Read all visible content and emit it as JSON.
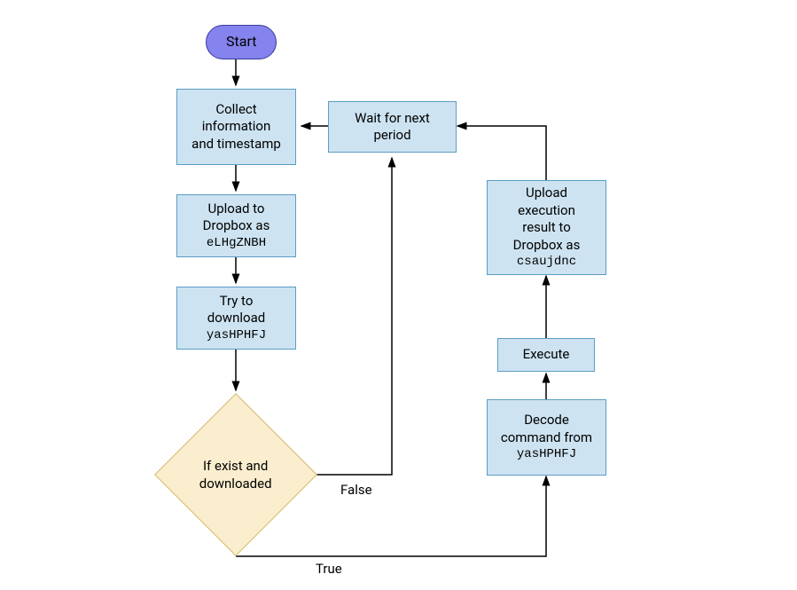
{
  "nodes": {
    "start": "Start",
    "collect": "Collect information and timestamp",
    "upload1_line1": "Upload to Dropbox as",
    "upload1_code": "eLHgZNBH",
    "download_line1": "Try to download",
    "download_code": "yasHPHFJ",
    "decision": "If exist and downloaded",
    "wait": "Wait for next period",
    "decode_line1": "Decode command from",
    "decode_code": "yasHPHFJ",
    "execute": "Execute",
    "upload2_line1": "Upload execution result to Dropbox as",
    "upload2_code": "csaujdnc"
  },
  "edges": {
    "false_label": "False",
    "true_label": "True"
  }
}
